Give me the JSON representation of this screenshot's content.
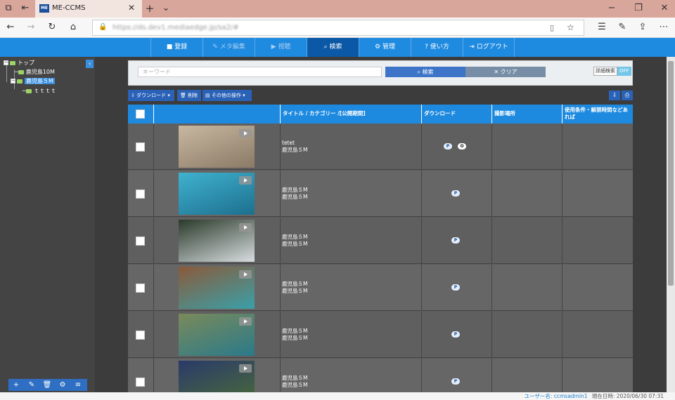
{
  "browser": {
    "tab_title": "ME-CCMS",
    "favicon_text": "ME",
    "url": "https://ds.dev1.mediaedge.jp/sa2/#"
  },
  "nav": {
    "items": [
      {
        "label": "登録",
        "icon": "file-icon"
      },
      {
        "label": "メタ編集",
        "icon": "pencil-icon"
      },
      {
        "label": "視聴",
        "icon": "play-icon"
      },
      {
        "label": "検索",
        "icon": "search-icon"
      },
      {
        "label": "管理",
        "icon": "gear-icon"
      },
      {
        "label": "使い方",
        "icon": "question-icon"
      },
      {
        "label": "ログアウト",
        "icon": "logout-icon"
      }
    ]
  },
  "sidebar": {
    "tree": [
      {
        "label": "トップ",
        "level": 0
      },
      {
        "label": "鹿児島10M",
        "level": 1
      },
      {
        "label": "鹿児島５M",
        "level": 1,
        "selected": true
      },
      {
        "label": "ｔｔｔｔ",
        "level": 2
      }
    ]
  },
  "search": {
    "placeholder": "キーワード",
    "search_label": "検索",
    "clear_label": "クリア",
    "advanced_label": "詳細検索",
    "advanced_state": "OFF"
  },
  "toolbar": {
    "download_label": "ダウンロード",
    "delete_label": "削除",
    "other_label": "その他の操作"
  },
  "table": {
    "headers": [
      "タイトル / カテゴリー /[公開期間]",
      "ダウンロード",
      "撮影場所",
      "使用条件・解禁時間などあれば"
    ],
    "rows": [
      {
        "title": "tetet",
        "category": "鹿児島５M",
        "badges": [
          "P",
          "O"
        ],
        "thumb": [
          "#c9b8a0",
          "#8a7a66"
        ]
      },
      {
        "title": "鹿児島５M",
        "category": "鹿児島５M",
        "badges": [
          "P"
        ],
        "thumb": [
          "#3fb2cf",
          "#1d6f8e"
        ]
      },
      {
        "title": "鹿児島５M",
        "category": "鹿児島５M",
        "badges": [
          "P"
        ],
        "thumb": [
          "#2a3a2a",
          "#d8dde0"
        ]
      },
      {
        "title": "鹿児島５M",
        "category": "鹿児島５M",
        "badges": [
          "P"
        ],
        "thumb": [
          "#8a5a3a",
          "#3aa0a8"
        ]
      },
      {
        "title": "鹿児島５M",
        "category": "鹿児島５M",
        "badges": [
          "P"
        ],
        "thumb": [
          "#7a8a5a",
          "#2a7a8a"
        ]
      },
      {
        "title": "鹿児島５M",
        "category": "鹿児島５M",
        "badges": [
          "P"
        ],
        "thumb": [
          "#2a3a6a",
          "#4a6a3a"
        ]
      }
    ]
  },
  "status": {
    "user": "ユーザー名: ccmsadmin1",
    "datetime": "現在日時: 2020/06/30 07:31"
  }
}
